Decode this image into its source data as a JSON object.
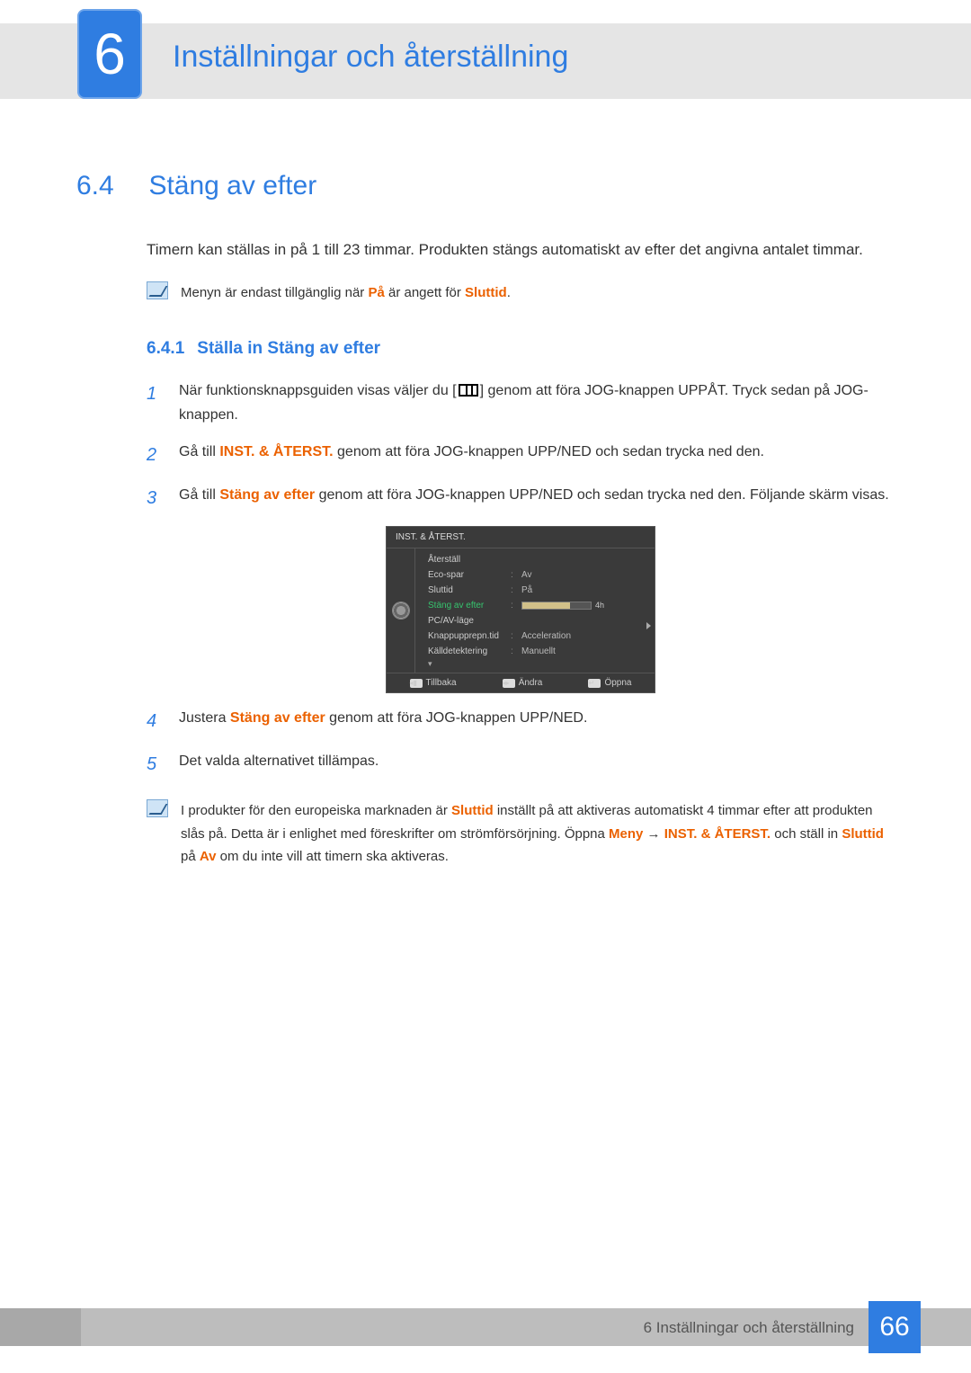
{
  "chapter": {
    "number": "6",
    "title": "Inställningar och återställning"
  },
  "section": {
    "number": "6.4",
    "title": "Stäng av efter"
  },
  "intro": "Timern kan ställas in på 1 till 23 timmar. Produkten stängs automatiskt av efter det angivna antalet timmar.",
  "note1": {
    "pre": "Menyn är endast tillgänglig när ",
    "hl1": "På",
    "mid": " är angett för ",
    "hl2": "Sluttid",
    "post": "."
  },
  "subsection": {
    "number": "6.4.1",
    "title": "Ställa in Stäng av efter"
  },
  "steps": {
    "s1a": "När funktionsknappsguiden visas väljer du [",
    "s1b": "] genom att föra JOG-knappen UPPÅT. Tryck sedan på JOG-knappen.",
    "s2a": "Gå till ",
    "s2hl": "INST. & ÅTERST.",
    "s2b": " genom att föra JOG-knappen UPP/NED och sedan trycka ned den.",
    "s3a": "Gå till ",
    "s3hl": "Stäng av efter",
    "s3b": " genom att föra JOG-knappen UPP/NED och sedan trycka ned den. Följande skärm visas.",
    "s4a": "Justera ",
    "s4hl": "Stäng av efter",
    "s4b": " genom att föra JOG-knappen UPP/NED.",
    "s5": "Det valda alternativet tillämpas."
  },
  "osd": {
    "title": "INST. & ÅTERST.",
    "rows": [
      {
        "label": "Återställ",
        "value": ""
      },
      {
        "label": "Eco-spar",
        "value": "Av"
      },
      {
        "label": "Sluttid",
        "value": "På"
      },
      {
        "label": "Stäng av efter",
        "value": "4h",
        "selected": true,
        "slider": true
      },
      {
        "label": "PC/AV-läge",
        "value": ""
      },
      {
        "label": "Knappupprepn.tid",
        "value": "Acceleration"
      },
      {
        "label": "Källdetektering",
        "value": "Manuellt"
      }
    ],
    "footer": {
      "back": "Tillbaka",
      "change": "Ändra",
      "open": "Öppna"
    }
  },
  "note2": {
    "pre": "I produkter för den europeiska marknaden är ",
    "hl1": "Sluttid",
    "mid1": " inställt på att aktiveras automatiskt 4 timmar efter att produkten slås på. Detta är i enlighet med föreskrifter om strömförsörjning. Öppna ",
    "hl2": "Meny",
    "arrow": " → ",
    "hl3": "INST. & ÅTERST.",
    "mid2": " och ställ in ",
    "hl4": "Sluttid",
    "mid3": " på ",
    "hl5": "Av",
    "post": " om du inte vill att timern ska aktiveras."
  },
  "footer": {
    "label": "6 Inställningar och återställning",
    "page": "66"
  }
}
